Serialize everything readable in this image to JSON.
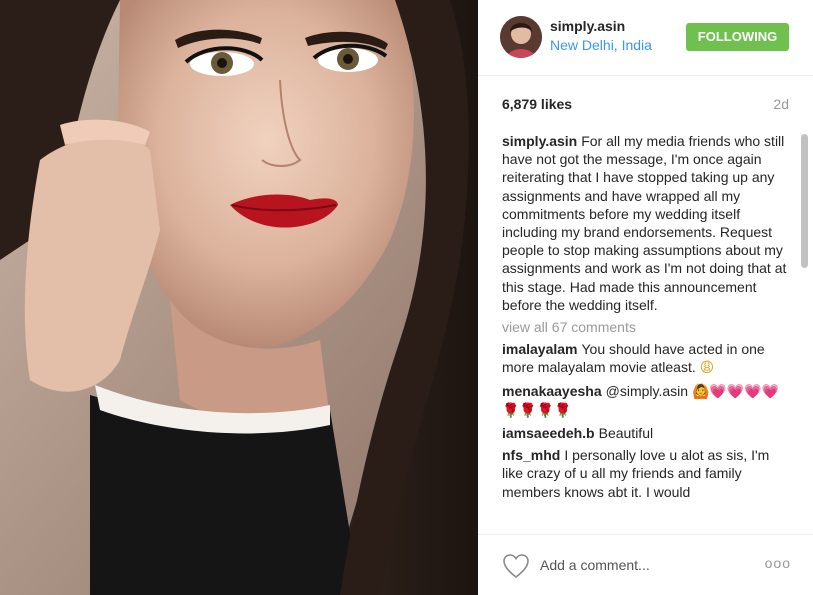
{
  "post": {
    "username": "simply.asin",
    "location": "New Delhi, India",
    "follow_label": "FOLLOWING",
    "likes": "6,879 likes",
    "time_ago": "2d"
  },
  "caption": {
    "author": "simply.asin",
    "text": "For all my media friends who still have not got the message, I'm once again reiterating that I have stopped taking up any assignments and have wrapped all my commitments before my wedding itself including my brand endorsements. Request people to stop making assumptions about my assignments and work as I'm not doing that at this stage. Had made this announcement before the wedding itself."
  },
  "view_all": "view all 67 comments",
  "comments": [
    {
      "author": "imalayalam",
      "text": "You should have acted in one more malayalam movie atleast.",
      "emoji": "😩"
    },
    {
      "author": "menakaayesha",
      "text": "@simply.asin",
      "emoji": "🙆💗💗💗💗 🌹🌹🌹🌹"
    },
    {
      "author": "iamsaeedeh.b",
      "text": "Beautiful"
    },
    {
      "author": "nfs_mhd",
      "text": "I personally love u alot as sis, I'm like crazy of u all my friends and family members knows abt it. I would"
    }
  ],
  "footer": {
    "comment_placeholder": "Add a comment...",
    "more_label": "ooo"
  },
  "icons": {
    "like": "heart-outline-icon",
    "more": "more-options-icon"
  },
  "colors": {
    "follow_button": "#70c050",
    "location_link": "#3897f0",
    "muted_text": "#999999"
  }
}
